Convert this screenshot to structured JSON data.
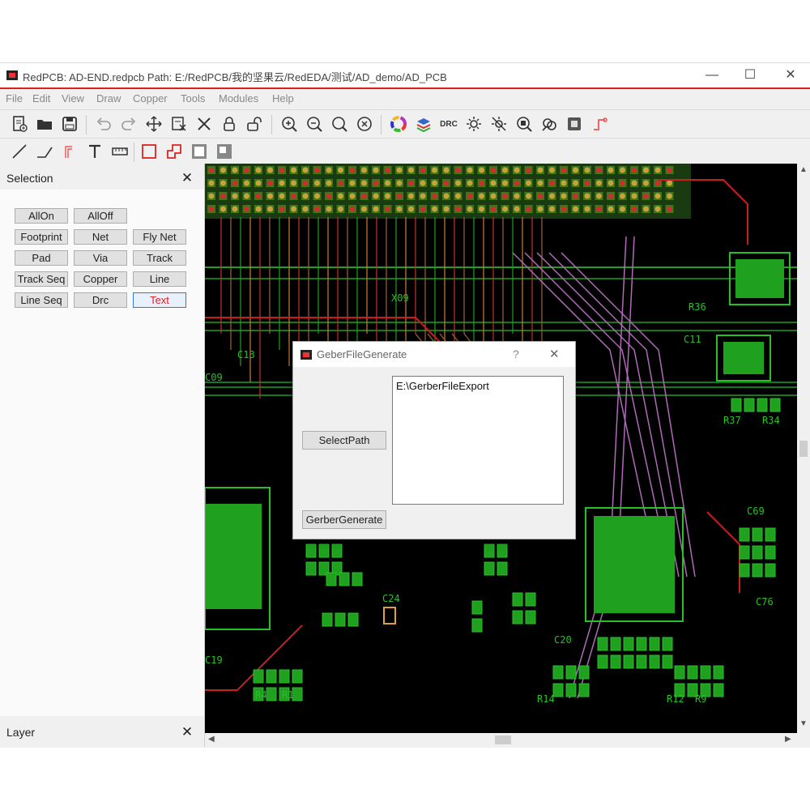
{
  "window": {
    "title": "RedPCB: AD-END.redpcb Path: E:/RedPCB/我的坚果云/RedEDA/测试/AD_demo/AD_PCB",
    "controls": {
      "minimize": "—",
      "maximize": "☐",
      "close": "✕"
    }
  },
  "menubar": [
    "File",
    "Edit",
    "View",
    "Draw",
    "Copper",
    "Tools",
    "Modules",
    "Help"
  ],
  "toolbar1": {
    "icons": [
      "new-file-icon",
      "open-folder-icon",
      "save-icon",
      "undo-icon",
      "redo-icon",
      "move-icon",
      "edit-select-icon",
      "delete-icon",
      "lock-icon",
      "unlock-icon",
      "zoom-in-icon",
      "zoom-out-icon",
      "zoom-fit-icon",
      "zoom-area-icon",
      "color-wheel-icon",
      "layers-icon",
      "drc-icon",
      "highlight-icon",
      "dim-icon",
      "inspect-icon",
      "net-icon",
      "component-icon",
      "route-icon"
    ],
    "drc_label": "DRC"
  },
  "toolbar2": {
    "icons": [
      "line-icon",
      "track-icon",
      "diff-pair-icon",
      "text-icon",
      "ruler-icon",
      "rectangle-icon",
      "polygon-icon",
      "fill-icon",
      "cutout-icon"
    ]
  },
  "selection_panel": {
    "title": "Selection",
    "buttons": [
      [
        "AllOn",
        "AllOff"
      ],
      [
        "Footprint",
        "Net",
        "Fly Net"
      ],
      [
        "Pad",
        "Via",
        "Track"
      ],
      [
        "Track Seq",
        "Copper",
        "Line"
      ],
      [
        "Line Seq",
        "Drc",
        "Text"
      ]
    ],
    "active_button": "Text"
  },
  "layer_panel": {
    "title": "Layer"
  },
  "pcb_labels": [
    "R36",
    "R37",
    "R34",
    "C69",
    "C76",
    "C20",
    "C24",
    "C19",
    "R14",
    "R12",
    "R9",
    "R1",
    "R4",
    "C13",
    "C11",
    "X09",
    "C09"
  ],
  "dialog": {
    "title": "GeberFileGenerate",
    "help": "?",
    "close": "✕",
    "select_path_label": "SelectPath",
    "generate_label": "GerberGenerate",
    "path_value": "E:\\GerberFileExport"
  },
  "colors": {
    "copper_top": "#1fa01f",
    "track_red": "#c81e1e",
    "track_pink": "#b06ab8",
    "track_brown": "#a0643c",
    "pad_green": "#27c127",
    "canvas_bg": "#000000",
    "title_accent": "#e02020"
  }
}
